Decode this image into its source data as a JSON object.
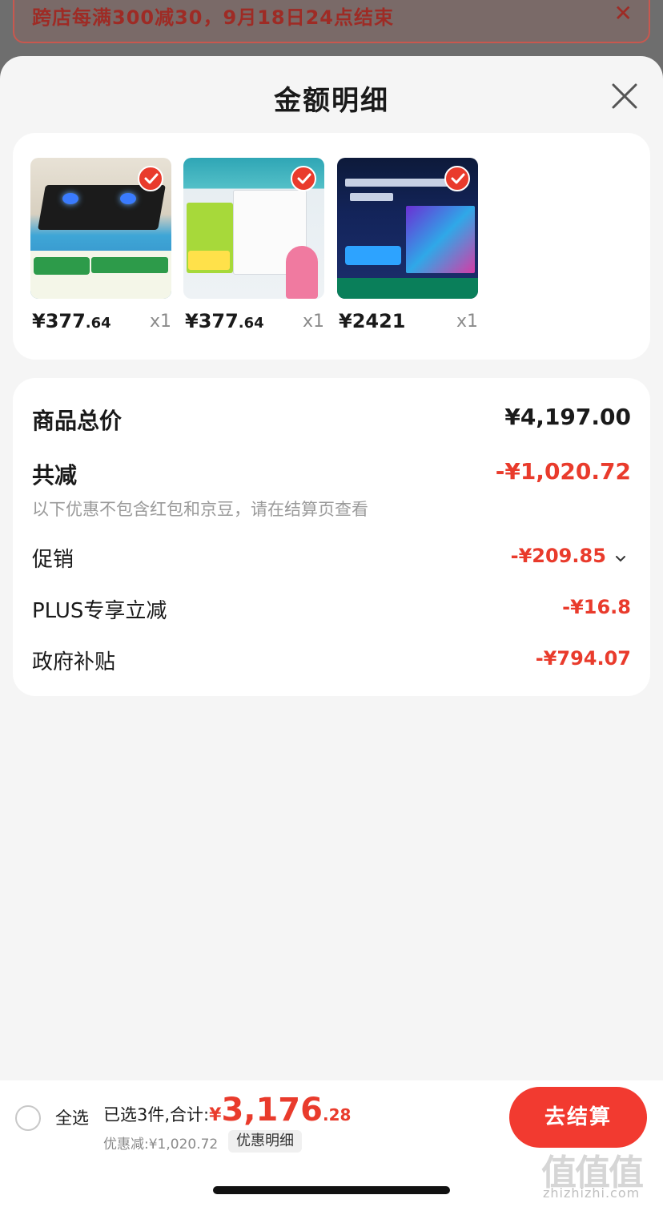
{
  "background_banner": {
    "text": "跨店每满300减30，9月18日24点结束",
    "close_glyph": "✕"
  },
  "sheet": {
    "title": "金额明细",
    "close_icon": "close-icon"
  },
  "products": [
    {
      "price_int": "¥377",
      "price_dec": ".64",
      "qty": "x1",
      "selected": true,
      "image": "gas-stove"
    },
    {
      "price_int": "¥377",
      "price_dec": ".64",
      "qty": "x1",
      "selected": true,
      "image": "mini-fridge"
    },
    {
      "price_int": "¥2421",
      "price_dec": "",
      "qty": "x1",
      "selected": true,
      "image": "mini-led-tv"
    }
  ],
  "summary": {
    "total_label": "商品总价",
    "total_value": "¥4,197.00",
    "reduce_label": "共减",
    "reduce_value": "-¥1,020.72",
    "reduce_note": "以下优惠不包含红包和京豆，请在结算页查看",
    "promo_label": "促销",
    "promo_value": "-¥209.85",
    "promo_chevron": "chevron-down-icon",
    "plus_label": "PLUS专享立减",
    "plus_value": "-¥16.8",
    "gov_label": "政府补贴",
    "gov_value": "-¥794.07"
  },
  "bottom": {
    "select_all": "全选",
    "selected_text": "已选3件,合计:",
    "total_symbol": "¥",
    "total_int": "3,176",
    "total_dec": ".28",
    "discount_text": "优惠减:¥1,020.72",
    "detail_chip": "优惠明细",
    "checkout": "去结算"
  },
  "watermark": {
    "glyphs": "值值值",
    "url": "zhizhizhi.com"
  },
  "colors": {
    "accent_red": "#e93b2c",
    "checkout_red": "#f23a30",
    "sheet_bg": "#f5f5f5",
    "card_bg": "#ffffff"
  }
}
